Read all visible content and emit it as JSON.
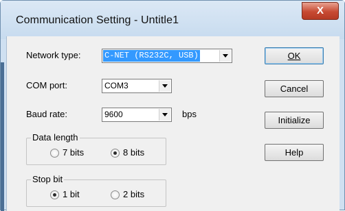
{
  "window": {
    "title": "Communication Setting - Untitle1",
    "close_label": "X"
  },
  "form": {
    "network_type": {
      "label": "Network type:",
      "value": "C-NET (RS232C, USB)"
    },
    "com_port": {
      "label": "COM port:",
      "value": "COM3"
    },
    "baud_rate": {
      "label": "Baud rate:",
      "value": "9600",
      "unit": "bps"
    }
  },
  "data_length": {
    "legend": "Data length",
    "options": [
      {
        "label": "7 bits",
        "checked": false
      },
      {
        "label": "8 bits",
        "checked": true
      }
    ]
  },
  "stop_bit": {
    "legend": "Stop bit",
    "options": [
      {
        "label": "1 bit",
        "checked": true
      },
      {
        "label": "2 bits",
        "checked": false
      }
    ]
  },
  "buttons": {
    "ok": "OK",
    "cancel": "Cancel",
    "initialize": "Initialize",
    "help": "Help"
  }
}
